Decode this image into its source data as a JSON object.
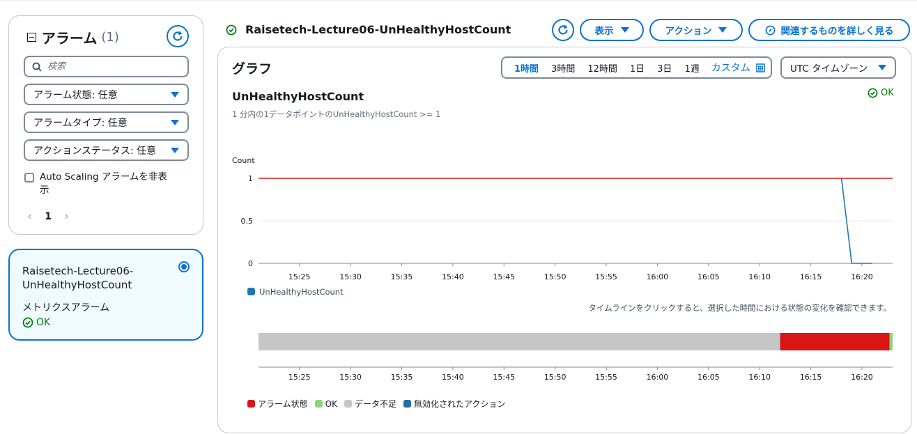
{
  "sidebar": {
    "title": "アラーム",
    "count": "(1)",
    "search_placeholder": "検索",
    "filters": [
      {
        "label": "アラーム状態: 任意"
      },
      {
        "label": "アラームタイプ: 任意"
      },
      {
        "label": "アクションステータス: 任意"
      }
    ],
    "checkbox_label": "Auto Scaling アラームを非表示",
    "page": "1"
  },
  "alarm_card": {
    "name": "Raisetech-Lecture06-UnHealthyHostCount",
    "type": "メトリクスアラーム",
    "status": "OK"
  },
  "header": {
    "alarm_name": "Raisetech-Lecture06-UnHealthyHostCount",
    "view_label": "表示",
    "action_label": "アクション",
    "related_label": "関連するものを詳しく見る"
  },
  "graph": {
    "title": "グラフ",
    "time_options": [
      "1時間",
      "3時間",
      "12時間",
      "1日",
      "3日",
      "1週"
    ],
    "active_time": "1時間",
    "custom_label": "カスタム",
    "timezone_label": "UTC タイムゾーン",
    "metric_title": "UnHealthyHostCount",
    "metric_subtitle": "1 分内の1データポイントのUnHealthyHostCount >= 1",
    "metric_status": "OK",
    "timeline_note": "タイムラインをクリックすると、選択した時間における状態の変化を確認できます。"
  },
  "colors": {
    "accent": "#0972d3",
    "alarm": "#d91515",
    "ok": "#037f0c",
    "ok_fill": "#8ed27d",
    "insufficient": "#c6c6c6",
    "disabled": "#1f6fa8",
    "series": "#1f77b4"
  },
  "chart_data": {
    "type": "line",
    "ylabel": "Count",
    "yticks": [
      "1",
      "0.5",
      "0"
    ],
    "ylim": [
      0,
      1
    ],
    "xticks": [
      "15:25",
      "15:30",
      "15:35",
      "15:40",
      "15:45",
      "15:50",
      "15:55",
      "16:00",
      "16:05",
      "16:10",
      "16:15",
      "16:20"
    ],
    "xlim_minutes": [
      "15:21",
      "16:23"
    ],
    "threshold": 1,
    "series": [
      {
        "name": "UnHealthyHostCount",
        "points": [
          [
            "16:18",
            1
          ],
          [
            "16:19",
            0
          ],
          [
            "16:20",
            0
          ],
          [
            "16:21",
            0
          ]
        ]
      }
    ],
    "legend": "UnHealthyHostCount",
    "timeline": {
      "segments": [
        {
          "state": "データ不足",
          "from": "15:21",
          "to": "16:12"
        },
        {
          "state": "アラーム状態",
          "from": "16:12",
          "to": "16:22.7"
        },
        {
          "state": "OK",
          "from": "16:22.7",
          "to": "16:23"
        }
      ],
      "legend": [
        "アラーム状態",
        "OK",
        "データ不足",
        "無効化されたアクション"
      ]
    }
  }
}
